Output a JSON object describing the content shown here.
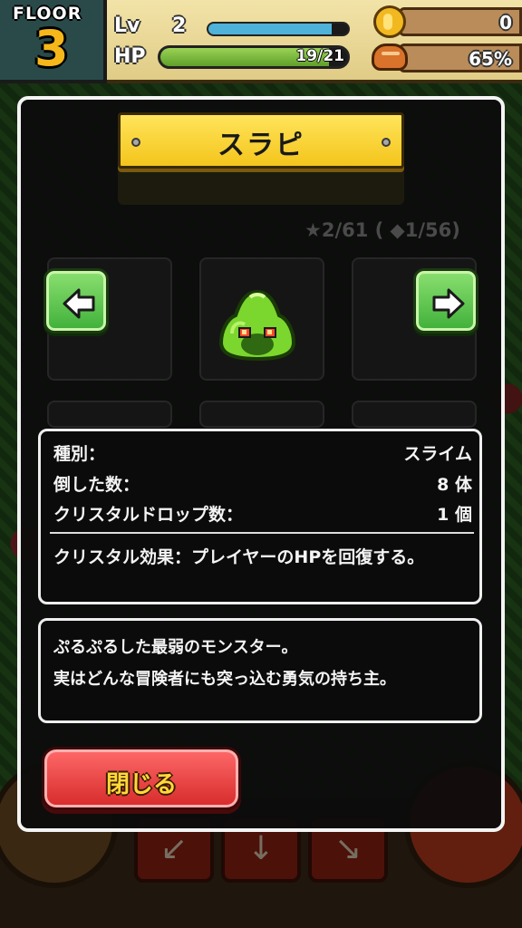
{
  "hud": {
    "floor_label": "FLOOR",
    "floor_number": "3",
    "level_label": "Lv",
    "level_value": "2",
    "hp_label": "HP",
    "hp_text": "19/21",
    "hp_fraction": 0.905,
    "exp_fraction": 0.88,
    "coins": "0",
    "food_percent": "65%",
    "colors": {
      "hp": "#6bb02e",
      "exp": "#4fb2d8",
      "floor_number": "#f6b71a"
    }
  },
  "modal": {
    "title": "スラピ",
    "counts": "★2/61 ( ◆1/56)",
    "info": {
      "type_label": "種別：",
      "type_value": "スライム",
      "defeated_label": "倒した数：",
      "defeated_value": "8 体",
      "drop_label": "クリスタルドロップ数：",
      "drop_value": "1 個",
      "effect_text": "クリスタル効果：プレイヤーのHPを回復する。"
    },
    "description_line1": "ぷるぷるした最弱のモンスター。",
    "description_line2": "実はどんな冒険者にも突っ込む勇気の持ち主。",
    "close_label": "閉じる",
    "icons": {
      "prev": "left-arrow-icon",
      "next": "right-arrow-icon",
      "monster": "green-slime"
    },
    "colors": {
      "title_plank": "#f4c51c",
      "close_button": "#e03a3a",
      "nav_button": "#4fbf3f"
    }
  }
}
